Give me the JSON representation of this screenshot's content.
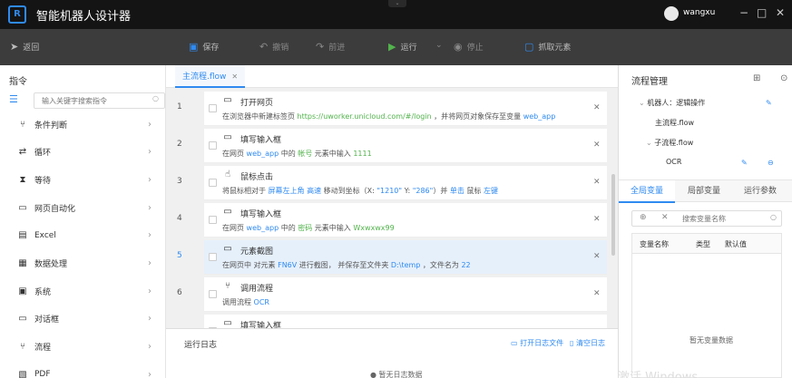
{
  "titlebar": {
    "logo_text": "R",
    "title": "智能机器人设计器",
    "notch": "⌄",
    "user": "wangxu",
    "minimize": "−",
    "maximize": "□",
    "close": "✕"
  },
  "toolbar": {
    "back": "返回",
    "save": "保存",
    "undo": "撤销",
    "redo": "前进",
    "run": "运行",
    "run_dropdown": "⌄",
    "stop": "停止",
    "capture": "抓取元素"
  },
  "left": {
    "title": "指令",
    "search_placeholder": "输入关键字搜索指令",
    "categories": [
      {
        "icon": "branch-icon",
        "glyph": "⑂",
        "label": "条件判断"
      },
      {
        "icon": "loop-icon",
        "glyph": "⇄",
        "label": "循环"
      },
      {
        "icon": "hourglass-icon",
        "glyph": "⧗",
        "label": "等待"
      },
      {
        "icon": "webpage-icon",
        "glyph": "▭",
        "label": "网页自动化"
      },
      {
        "icon": "excel-icon",
        "glyph": "▤",
        "label": "Excel"
      },
      {
        "icon": "data-icon",
        "glyph": "▦",
        "label": "数据处理"
      },
      {
        "icon": "terminal-icon",
        "glyph": "▣",
        "label": "系统"
      },
      {
        "icon": "dialog-icon",
        "glyph": "▭",
        "label": "对话框"
      },
      {
        "icon": "flow-icon",
        "glyph": "⑂",
        "label": "流程"
      },
      {
        "icon": "pdf-icon",
        "glyph": "▧",
        "label": "PDF"
      }
    ]
  },
  "editor": {
    "tab": "主流程.flow",
    "line_numbers": [
      "1",
      "2",
      "3",
      "4",
      "5",
      "6"
    ],
    "steps": [
      {
        "icon": "browser-icon",
        "glyph": "▭",
        "title": "打开网页",
        "desc": [
          [
            "在浏览器中新建标签页 ",
            ""
          ],
          [
            "https://uworker.unicloud.com/#/login",
            "g"
          ],
          [
            " ，并将网页对象保存至变量 ",
            ""
          ],
          [
            "web_app",
            "b"
          ]
        ]
      },
      {
        "icon": "input-box-icon",
        "glyph": "▭",
        "title": "填写输入框",
        "desc": [
          [
            "在网页 ",
            ""
          ],
          [
            "web_app",
            "b"
          ],
          [
            " 中的 ",
            ""
          ],
          [
            "帐号",
            "g"
          ],
          [
            " 元素中输入 ",
            ""
          ],
          [
            "1111",
            "g"
          ]
        ]
      },
      {
        "icon": "mouse-click-icon",
        "glyph": "☝",
        "title": "鼠标点击",
        "desc": [
          [
            "将鼠标相对于 ",
            ""
          ],
          [
            "屏幕左上角",
            "b"
          ],
          [
            " ",
            ""
          ],
          [
            "高速",
            "b"
          ],
          [
            " 移动到坐标（X: ",
            ""
          ],
          [
            "\"1210\"",
            "b"
          ],
          [
            " Y: ",
            ""
          ],
          [
            "\"286\"",
            "b"
          ],
          [
            "）并 ",
            ""
          ],
          [
            "单击",
            "b"
          ],
          [
            " 鼠标 ",
            ""
          ],
          [
            "左键",
            "b"
          ]
        ]
      },
      {
        "icon": "input-box-icon",
        "glyph": "▭",
        "title": "填写输入框",
        "desc": [
          [
            "在网页 ",
            ""
          ],
          [
            "web_app",
            "b"
          ],
          [
            " 中的 ",
            ""
          ],
          [
            "密码",
            "g"
          ],
          [
            " 元素中输入 ",
            ""
          ],
          [
            "Wxwxwx99",
            "g"
          ]
        ]
      },
      {
        "icon": "screenshot-icon",
        "glyph": "▭",
        "title": "元素截图",
        "desc": [
          [
            "在网页中 对元素 ",
            ""
          ],
          [
            "FN6V",
            "b"
          ],
          [
            " 进行截图， 并保存至文件夹 ",
            ""
          ],
          [
            "D:\\temp",
            "b"
          ],
          [
            " ，文件名为 ",
            ""
          ],
          [
            "22",
            "b"
          ]
        ]
      },
      {
        "icon": "call-flow-icon",
        "glyph": "⑂",
        "title": "调用流程",
        "desc": [
          [
            "调用流程 ",
            ""
          ],
          [
            "OCR",
            "b"
          ]
        ]
      },
      {
        "icon": "input-box-icon",
        "glyph": "▭",
        "title": "填写输入框",
        "desc": []
      }
    ]
  },
  "log": {
    "title": "运行日志",
    "open_file": "打开日志文件",
    "clear": "清空日志",
    "empty": "暂无日志数据"
  },
  "right": {
    "title": "流程管理",
    "tree": {
      "robot": "机器人：逻辑操作",
      "main_flow": "主流程.flow",
      "sub_group": "子流程.flow",
      "ocr": "OCR"
    },
    "tabs": [
      "全局变量",
      "局部变量",
      "运行参数"
    ],
    "var_search_placeholder": "搜索变量名称",
    "columns": [
      "变量名称",
      "类型",
      "默认值"
    ],
    "empty": "暂无变量数据"
  },
  "watermark": "激活 Windows",
  "colors": {
    "accent": "#2f8af0",
    "green": "#52b34c",
    "titlebar": "#141414",
    "toolbar": "#3c3c3c"
  }
}
